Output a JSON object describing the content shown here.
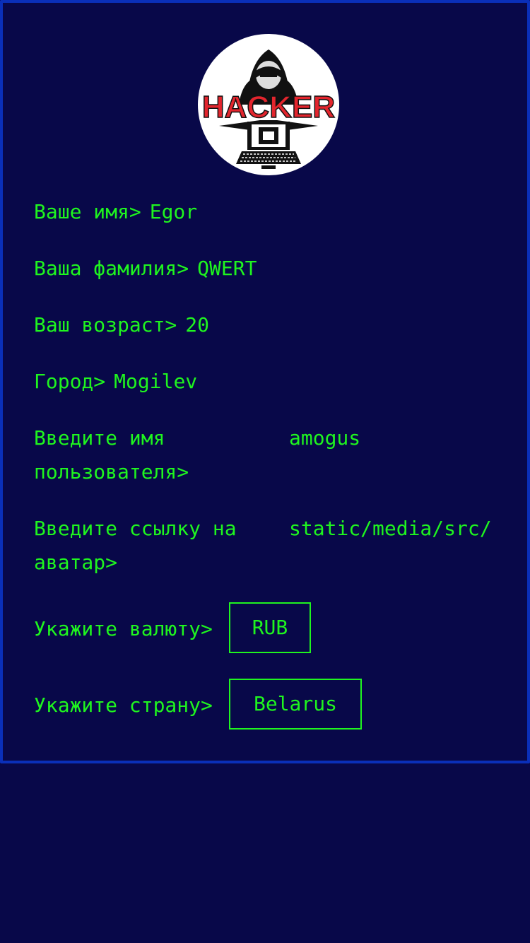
{
  "profile": {
    "avatar_alt": "HACKER",
    "fields": [
      {
        "label": "Ваше имя>",
        "value": "Egor"
      },
      {
        "label": "Ваша фамилия>",
        "value": "QWERT"
      },
      {
        "label": "Ваш возраст>",
        "value": "20"
      },
      {
        "label": "Город>",
        "value": "Mogilev"
      }
    ],
    "username": {
      "label": "Введите имя пользователя>",
      "value": "amogus"
    },
    "avatar_link": {
      "label": "Введите ссылку на аватар>",
      "value": "static/media/src/"
    },
    "currency": {
      "label": "Укажите валюту>",
      "value": "RUB"
    },
    "country": {
      "label": "Укажите страну>",
      "value": "Belarus"
    }
  },
  "colors": {
    "background": "#080849",
    "border": "#0a2fb8",
    "text": "#1ff51f",
    "logo_red": "#e3252d"
  },
  "icons": [
    "hacker-avatar-icon"
  ]
}
